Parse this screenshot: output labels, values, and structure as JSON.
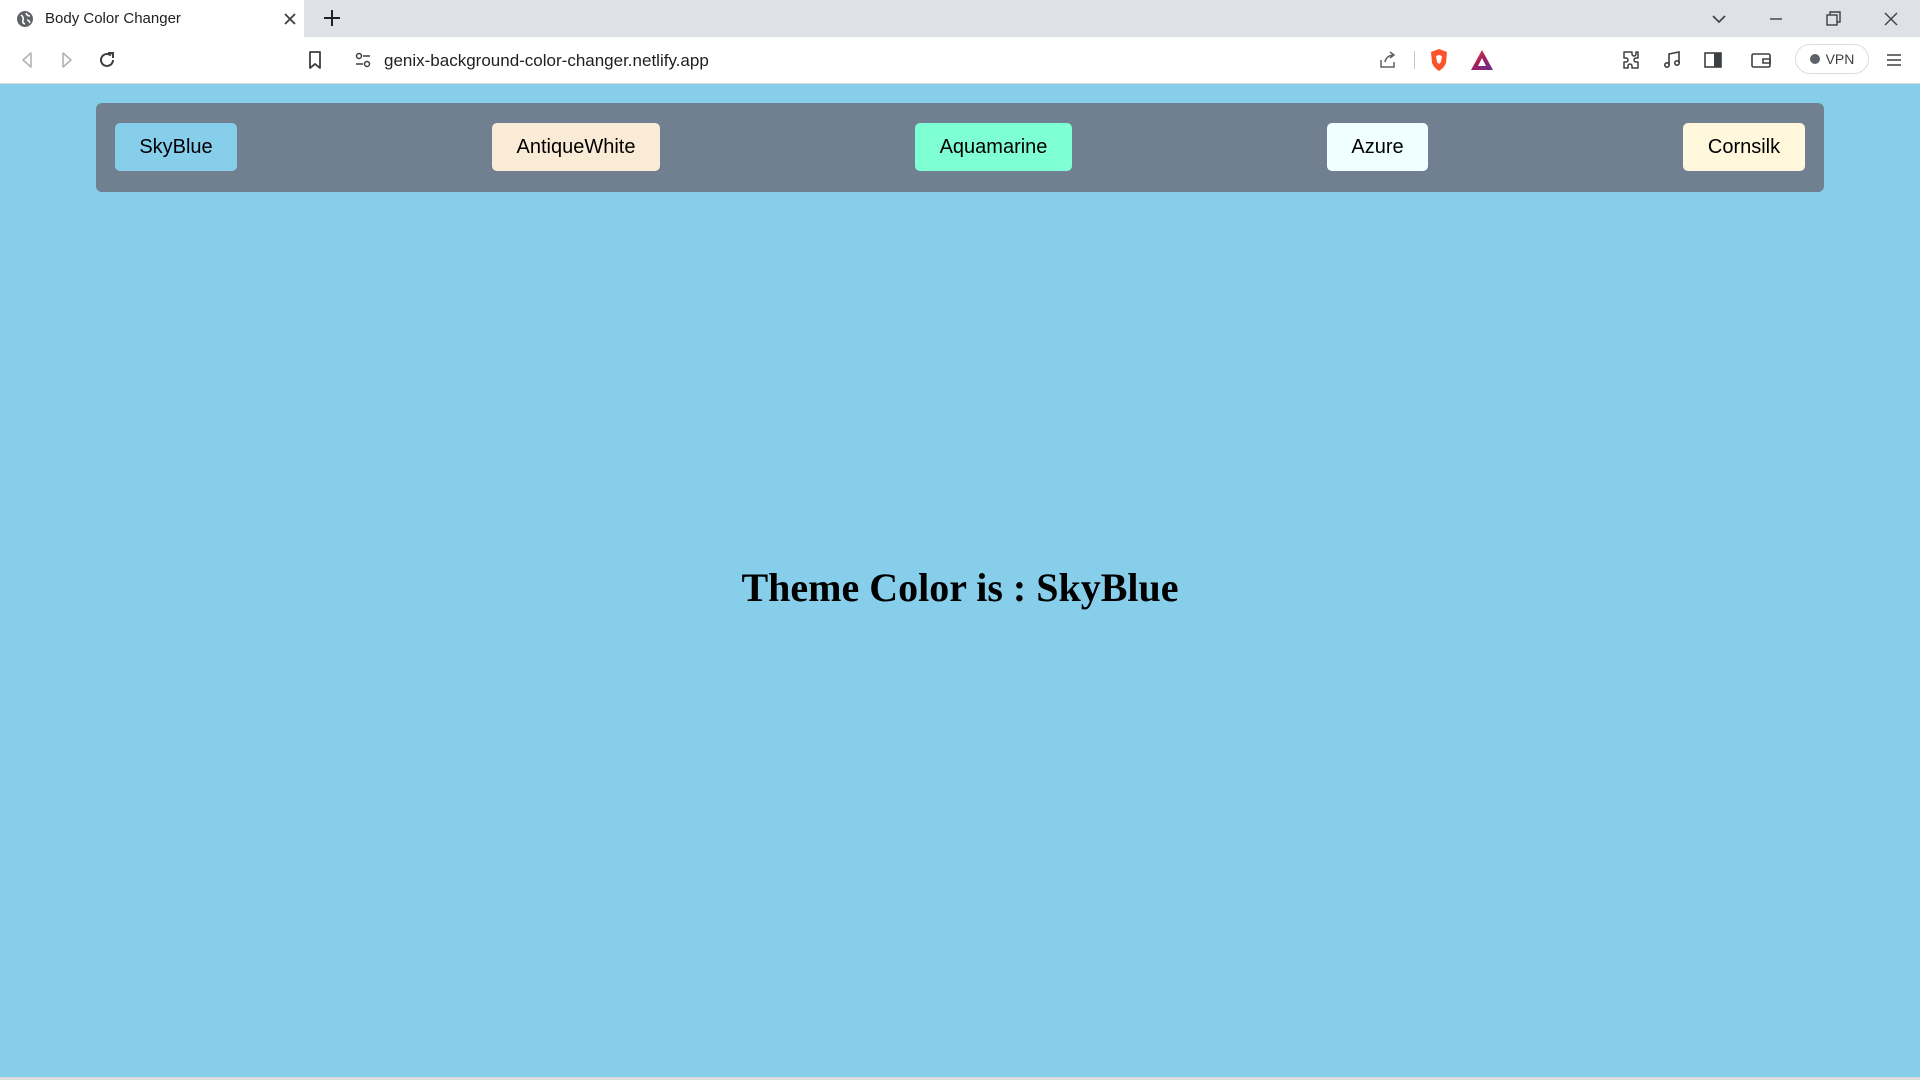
{
  "browser": {
    "tab_title": "Body Color Changer",
    "url": "genix-background-color-changer.netlify.app",
    "vpn_label": "VPN",
    "icons": [
      "globe-icon",
      "close-icon",
      "plus-icon",
      "chevron-down-icon",
      "minimize-icon",
      "restore-icon",
      "close-window-icon",
      "back-icon",
      "forward-icon",
      "reload-icon",
      "bookmark-icon",
      "site-info-icon",
      "share-icon",
      "brave-shield-icon",
      "brave-rewards-icon",
      "extensions-icon",
      "media-icon",
      "sidebar-icon",
      "wallet-icon",
      "menu-icon"
    ]
  },
  "page": {
    "background": "#87ceeb",
    "bar_color": "#708090",
    "buttons": [
      {
        "label": "SkyBlue",
        "color": "#87ceeb"
      },
      {
        "label": "AntiqueWhite",
        "color": "#faebd7"
      },
      {
        "label": "Aquamarine",
        "color": "#7fffd4"
      },
      {
        "label": "Azure",
        "color": "#f0ffff"
      },
      {
        "label": "Cornsilk",
        "color": "#fff8dc"
      }
    ],
    "heading": "Theme Color is : SkyBlue"
  }
}
